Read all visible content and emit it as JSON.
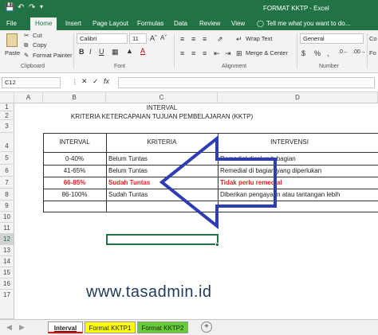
{
  "window": {
    "title": "FORMAT KKTP - Excel"
  },
  "ribbon_tabs": [
    "File",
    "Home",
    "Insert",
    "Page Layout",
    "Formulas",
    "Data",
    "Review",
    "View"
  ],
  "tell_me": "Tell me what you want to do...",
  "clipboard": {
    "cut": "Cut",
    "copy": "Copy",
    "paste": "Paste",
    "format_painter": "Format Painter",
    "group": "Clipboard"
  },
  "font": {
    "name": "Calibri",
    "size": "11",
    "bold": "B",
    "italic": "I",
    "underline": "U",
    "group": "Font"
  },
  "alignment": {
    "wrap": "Wrap Text",
    "merge": "Merge & Center",
    "group": "Alignment"
  },
  "number": {
    "format": "General",
    "group": "Number",
    "currency": "$",
    "percent": "%",
    "comma": ","
  },
  "styles": {
    "cond": "Co",
    "fo": "Fo"
  },
  "formula_bar": {
    "name_box": "C12",
    "fx": "fx",
    "value": ""
  },
  "columns": [
    "A",
    "B",
    "C",
    "D"
  ],
  "rows": [
    "1",
    "2",
    "3",
    "4",
    "5",
    "6",
    "7",
    "8",
    "9",
    "10",
    "11",
    "12",
    "13",
    "14",
    "15",
    "16",
    "17"
  ],
  "sheet": {
    "title1": "INTERVAL",
    "title2": "KRITERIA KETERCAPAIAN TUJUAN PEMBELAJARAN (KKTP)",
    "headers": [
      "INTERVAL",
      "KRITERIA",
      "INTERVENSI"
    ],
    "table": [
      {
        "interval": "0-40%",
        "kriteria": "Belum Tuntas",
        "intervensi": "Remedial diseluruh bagian"
      },
      {
        "interval": "41-65%",
        "kriteria": "Belum Tuntas",
        "intervensi": "Remedial di bagian yang diperlukan"
      },
      {
        "interval": "66-85%",
        "kriteria": "Sudah Tuntas",
        "intervensi": "Tidak perlu remedial"
      },
      {
        "interval": "86-100%",
        "kriteria": "Sudah Tuntas",
        "intervensi": "Diberikan pengayaan atau tantangan lebih"
      }
    ],
    "highlight_color": "#e02020",
    "watermark": "www.tasadmin.id"
  },
  "sheet_tabs": [
    {
      "label": "Interval",
      "color": "#ff0000"
    },
    {
      "label": "Format KKTP1",
      "color": "#ffff00"
    },
    {
      "label": "Format KKTP2",
      "color": "#66cc33"
    }
  ],
  "add_sheet": "+",
  "colors": {
    "excel_green": "#217346",
    "arrow_blue": "#2f3db5"
  }
}
